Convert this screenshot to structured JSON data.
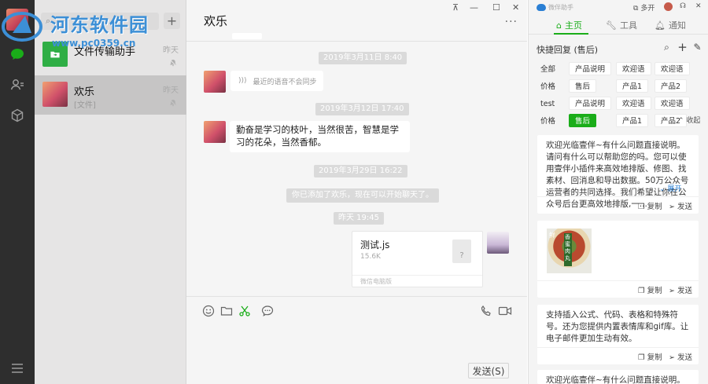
{
  "watermark": {
    "title": "河东软件园",
    "url": "www.pc0359.cn"
  },
  "conversations": [
    {
      "name": "文件传输助手",
      "preview": "",
      "time": "昨天",
      "muted": true
    },
    {
      "name": "欢乐",
      "preview": "[文件]",
      "time": "昨天",
      "muted": true
    }
  ],
  "chat": {
    "title": "欢乐",
    "timestamps": [
      "2019年3月11日 8:40",
      "2019年3月12日 17:40",
      "2019年3月29日 16:22",
      "昨天 19:45"
    ],
    "voice_note": "最近的语音不会同步",
    "text_message": "勤奋是学习的枝叶，当然很苦，智慧是学习的花朵，当然香郁。",
    "system_tip": "你已添加了欢乐，现在可以开始聊天了。",
    "file": {
      "name": "测试.js",
      "size": "15.6K",
      "icon_glyph": "?",
      "source": "微信电脑版"
    },
    "send_label": "发送(S)"
  },
  "assistant": {
    "app_name": "微伴助手",
    "multi_open": "多开",
    "tabs": [
      "主页",
      "工具",
      "通知"
    ],
    "active_tab": 0,
    "quick_reply_title": "快捷回复 (售后)",
    "chip_rows": [
      [
        "全部",
        "产品说明",
        "欢迎语",
        "欢迎语"
      ],
      [
        "价格",
        "售后",
        "产品1",
        "产品2"
      ],
      [
        "test",
        "产品说明",
        "欢迎语",
        "欢迎语"
      ],
      [
        "价格",
        "售后",
        "产品1",
        "产品2"
      ]
    ],
    "selected_chip": "售后",
    "collapse_label": "收起",
    "expand_label": "展开",
    "copy_label": "复制",
    "send_label": "发送",
    "cards": [
      "欢迎光临壹伴~有什么问题直接说明。请问有什么可以帮助您的吗。您可以使用壹伴小插件来高效地排版、修图、找素材、回消息和导出数据。50万公众号运营者的共同选择。我们希望让你在公众号后台更高效地排版,一...",
      "",
      "支持插入公式、代码、表格和特殊符号。还为您提供内置表情库和gif库。让电子邮件更加生动有效。",
      "欢迎光临壹伴~有什么问题直接说明。请问有什"
    ],
    "thumb_badge": "鲜",
    "thumb_label": "香蜜肉丸"
  },
  "colors": {
    "accent_green": "#1aad19",
    "nav_bg": "#2e2e2e",
    "link_blue": "#2a7fd4"
  }
}
